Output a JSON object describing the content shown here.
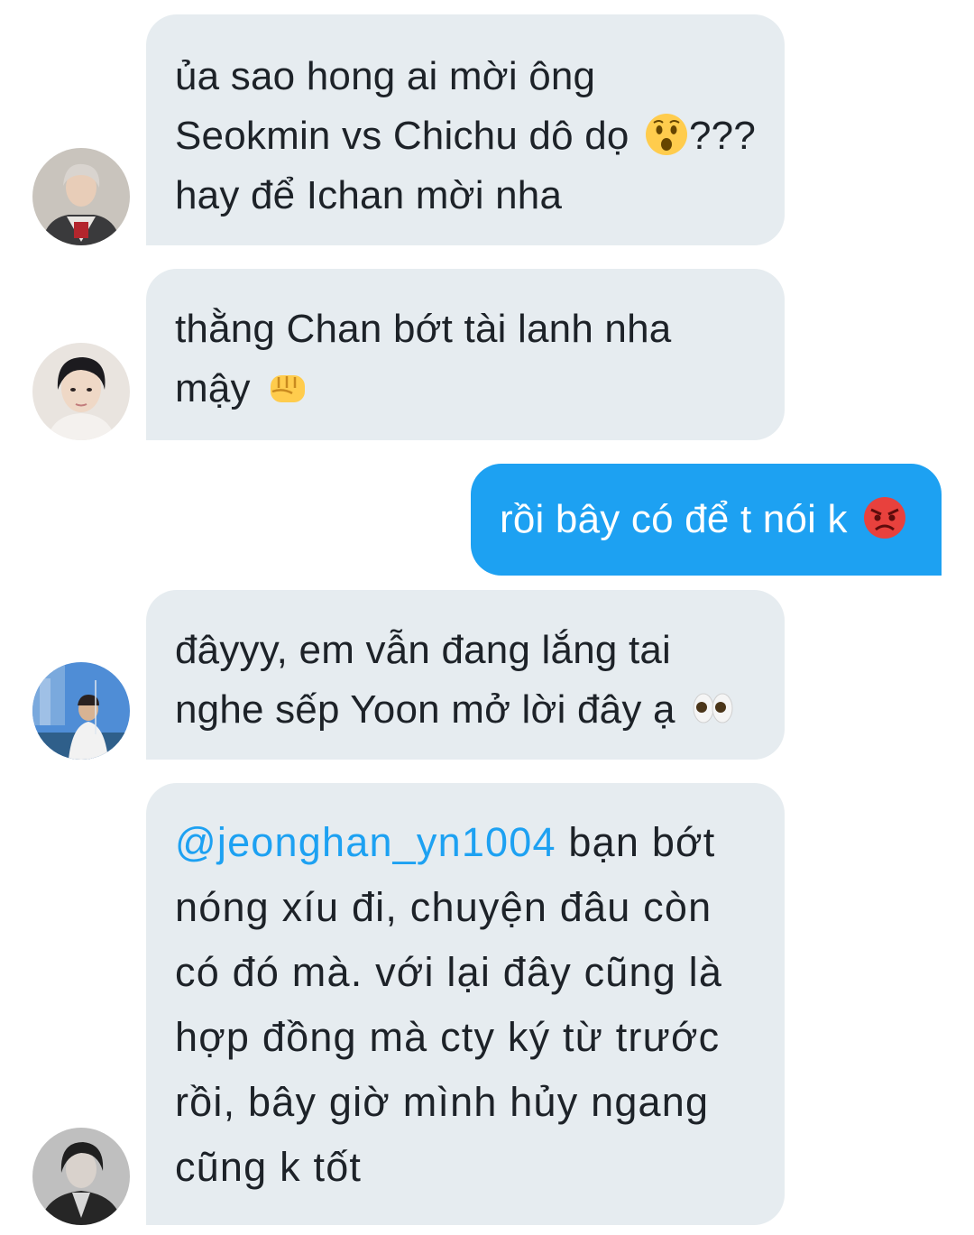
{
  "messages": [
    {
      "id": "m1",
      "direction": "incoming",
      "avatar": "avatar-user-1",
      "lines": [
        "ủa sao hong ai mời ông",
        "Seokmin vs Chichu dô dọ",
        "???",
        "hay để Ichan mời nha"
      ],
      "emoji": "astonished-face-emoji"
    },
    {
      "id": "m2",
      "direction": "incoming",
      "avatar": "avatar-user-2",
      "lines": [
        "thằng Chan bớt tài lanh nha",
        "mậy"
      ],
      "emoji": "oncoming-fist-emoji"
    },
    {
      "id": "m3",
      "direction": "outgoing",
      "lines": [
        "rồi bây có để t nói k"
      ],
      "emoji": "pouting-face-emoji"
    },
    {
      "id": "m4",
      "direction": "incoming",
      "avatar": "avatar-user-3",
      "lines": [
        "đâyyy, em vẫn đang lắng tai",
        "nghe sếp Yoon mở lời đây ạ"
      ],
      "emoji": "eyes-emoji"
    },
    {
      "id": "m5",
      "direction": "incoming",
      "avatar": "avatar-user-4",
      "mention": "@jeonghan_yn1004",
      "lines": [
        " bạn bớt",
        "nóng xíu đi, chuyện đâu còn",
        "có đó mà. với lại đây cũng là",
        "hợp đồng mà cty ký từ trước",
        "rồi, bây giờ mình hủy ngang",
        "cũng k tốt"
      ]
    }
  ],
  "colors": {
    "incoming_bubble": "#e6ecf0",
    "outgoing_bubble": "#1da1f2",
    "mention": "#1da1f2",
    "text": "#1d2228"
  }
}
